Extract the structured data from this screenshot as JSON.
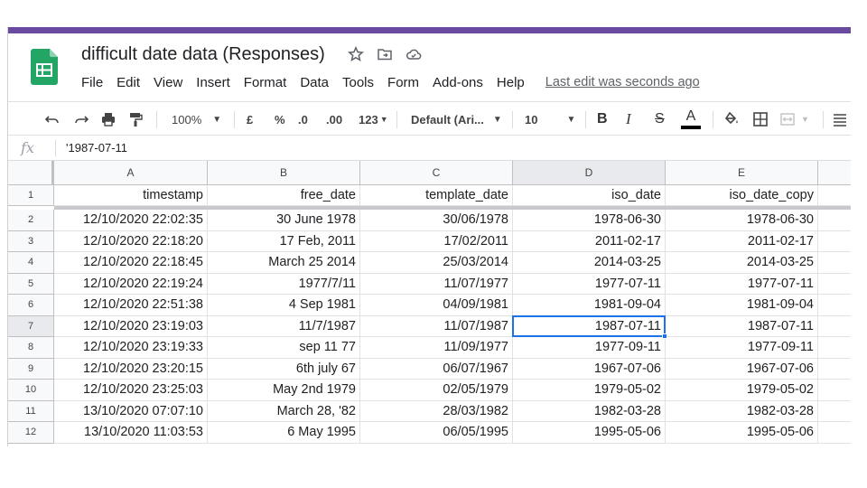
{
  "app": {
    "title": "difficult date data (Responses)",
    "accent_color": "#6a4aa0",
    "logo_icon": "google-sheets-icon",
    "logo_color": "#23a566"
  },
  "title_icons": [
    "star-icon",
    "move-to-folder-icon",
    "cloud-status-icon"
  ],
  "menu": {
    "items": [
      "File",
      "Edit",
      "View",
      "Insert",
      "Format",
      "Data",
      "Tools",
      "Form",
      "Add-ons",
      "Help"
    ],
    "last_edit": "Last edit was seconds ago"
  },
  "toolbar": {
    "zoom": "100%",
    "currency": "£",
    "percent": "%",
    "decrease_decimal": ".0",
    "increase_decimal": ".00",
    "more_formats": "123",
    "font": "Default (Ari...",
    "font_size": "10",
    "bold": "B",
    "italic": "I",
    "strikethrough": "S",
    "text_color": "A",
    "text_color_value": "#000000"
  },
  "formula_bar": {
    "fx_label": "fx",
    "value": "'1987-07-11"
  },
  "sheet": {
    "columns": [
      "A",
      "B",
      "C",
      "D",
      "E"
    ],
    "selected_column": "D",
    "selected_row": "7",
    "rows": [
      {
        "num": "1",
        "cells": [
          "timestamp",
          "free_date",
          "template_date",
          "iso_date",
          "iso_date_copy"
        ]
      },
      {
        "num": "2",
        "cells": [
          "12/10/2020 22:02:35",
          "30 June 1978",
          "30/06/1978",
          "1978-06-30",
          "1978-06-30"
        ]
      },
      {
        "num": "3",
        "cells": [
          "12/10/2020 22:18:20",
          "17 Feb, 2011",
          "17/02/2011",
          "2011-02-17",
          "2011-02-17"
        ]
      },
      {
        "num": "4",
        "cells": [
          "12/10/2020 22:18:45",
          "March 25 2014",
          "25/03/2014",
          "2014-03-25",
          "2014-03-25"
        ]
      },
      {
        "num": "5",
        "cells": [
          "12/10/2020 22:19:24",
          "1977/7/11",
          "11/07/1977",
          "1977-07-11",
          "1977-07-11"
        ]
      },
      {
        "num": "6",
        "cells": [
          "12/10/2020 22:51:38",
          "4 Sep 1981",
          "04/09/1981",
          "1981-09-04",
          "1981-09-04"
        ]
      },
      {
        "num": "7",
        "cells": [
          "12/10/2020 23:19:03",
          "11/7/1987",
          "11/07/1987",
          "1987-07-11",
          "1987-07-11"
        ]
      },
      {
        "num": "8",
        "cells": [
          "12/10/2020 23:19:33",
          "sep 11 77",
          "11/09/1977",
          "1977-09-11",
          "1977-09-11"
        ]
      },
      {
        "num": "9",
        "cells": [
          "12/10/2020 23:20:15",
          "6th july 67",
          "06/07/1967",
          "1967-07-06",
          "1967-07-06"
        ]
      },
      {
        "num": "10",
        "cells": [
          "12/10/2020 23:25:03",
          "May 2nd 1979",
          "02/05/1979",
          "1979-05-02",
          "1979-05-02"
        ]
      },
      {
        "num": "11",
        "cells": [
          "13/10/2020 07:07:10",
          "March 28, '82",
          "28/03/1982",
          "1982-03-28",
          "1982-03-28"
        ]
      },
      {
        "num": "12",
        "cells": [
          "13/10/2020 11:03:53",
          "6 May 1995",
          "06/05/1995",
          "1995-05-06",
          "1995-05-06"
        ]
      }
    ]
  }
}
